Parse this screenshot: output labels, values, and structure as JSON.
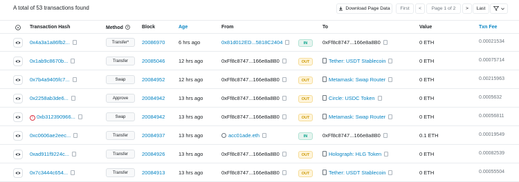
{
  "summary": "A total of 53 transactions found",
  "toolbar": {
    "download_label": "Download Page Data",
    "first_label": "First",
    "prev_label": "<",
    "page_label": "Page 1 of 2",
    "next_label": ">",
    "last_label": "Last"
  },
  "headers": {
    "help": "?",
    "hash": "Transaction Hash",
    "method": "Method",
    "block": "Block",
    "age": "Age",
    "from": "From",
    "to": "To",
    "value": "Value",
    "fee": "Txn Fee"
  },
  "rows": [
    {
      "hash": "0x4a3a1a86fb2...",
      "error": false,
      "method": "Transfer*",
      "block": "20086970",
      "age": "6 hrs ago",
      "from": "0x81d012ED...5818C2404",
      "from_link": true,
      "from_icon": "",
      "dir": "IN",
      "to": "0xFf8c8747...166e8a8B0",
      "to_link": false,
      "to_icon": "",
      "value": "0 ETH",
      "fee": "0.00021534"
    },
    {
      "hash": "0x1ab9c8670b...",
      "error": false,
      "method": "Transfer",
      "block": "20085046",
      "age": "12 hrs ago",
      "from": "0xFf8c8747...166e8a8B0",
      "from_link": false,
      "from_icon": "",
      "dir": "OUT",
      "to": "Tether: USDT Stablecoin",
      "to_link": true,
      "to_icon": "doc",
      "value": "0 ETH",
      "fee": "0.00075714"
    },
    {
      "hash": "0x7b4a9405fc7...",
      "error": false,
      "method": "Swap",
      "block": "20084952",
      "age": "12 hrs ago",
      "from": "0xFf8c8747...166e8a8B0",
      "from_link": false,
      "from_icon": "",
      "dir": "OUT",
      "to": "Metamask: Swap Router",
      "to_link": true,
      "to_icon": "doc",
      "value": "0 ETH",
      "fee": "0.00215963"
    },
    {
      "hash": "0x2258ab3de6...",
      "error": false,
      "method": "Approve",
      "block": "20084942",
      "age": "13 hrs ago",
      "from": "0xFf8c8747...166e8a8B0",
      "from_link": false,
      "from_icon": "",
      "dir": "OUT",
      "to": "Circle: USDC Token",
      "to_link": true,
      "to_icon": "doc",
      "value": "0 ETH",
      "fee": "0.0005632"
    },
    {
      "hash": "0xb312390966...",
      "error": true,
      "method": "Swap",
      "block": "20084942",
      "age": "13 hrs ago",
      "from": "0xFf8c8747...166e8a8B0",
      "from_link": false,
      "from_icon": "",
      "dir": "OUT",
      "to": "Metamask: Swap Router",
      "to_link": true,
      "to_icon": "doc",
      "value": "0 ETH",
      "fee": "0.00056811"
    },
    {
      "hash": "0xc0606ae2eec...",
      "error": false,
      "method": "Transfer",
      "block": "20084937",
      "age": "13 hrs ago",
      "from": "acc01ade.eth",
      "from_link": true,
      "from_icon": "loop",
      "dir": "IN",
      "to": "0xFf8c8747...166e8a8B0",
      "to_link": false,
      "to_icon": "",
      "value": "0.1 ETH",
      "fee": "0.00019549"
    },
    {
      "hash": "0xad911f9224c...",
      "error": false,
      "method": "Transfer",
      "block": "20084926",
      "age": "13 hrs ago",
      "from": "0xFf8c8747...166e8a8B0",
      "from_link": false,
      "from_icon": "",
      "dir": "OUT",
      "to": "Holograph: HLG Token",
      "to_link": true,
      "to_icon": "doc",
      "value": "0 ETH",
      "fee": "0.00082539"
    },
    {
      "hash": "0x7c3444c654...",
      "error": false,
      "method": "Transfer",
      "block": "20084913",
      "age": "13 hrs ago",
      "from": "0xFf8c8747...166e8a8B0",
      "from_link": false,
      "from_icon": "",
      "dir": "OUT",
      "to": "Tether: USDT Stablecoin",
      "to_link": true,
      "to_icon": "doc",
      "value": "0 ETH",
      "fee": "0.00055504"
    }
  ],
  "colors": {
    "link": "#0784c3",
    "in_badge": "#00a186",
    "out_badge": "#cc9a06",
    "border": "#e9ecef"
  }
}
